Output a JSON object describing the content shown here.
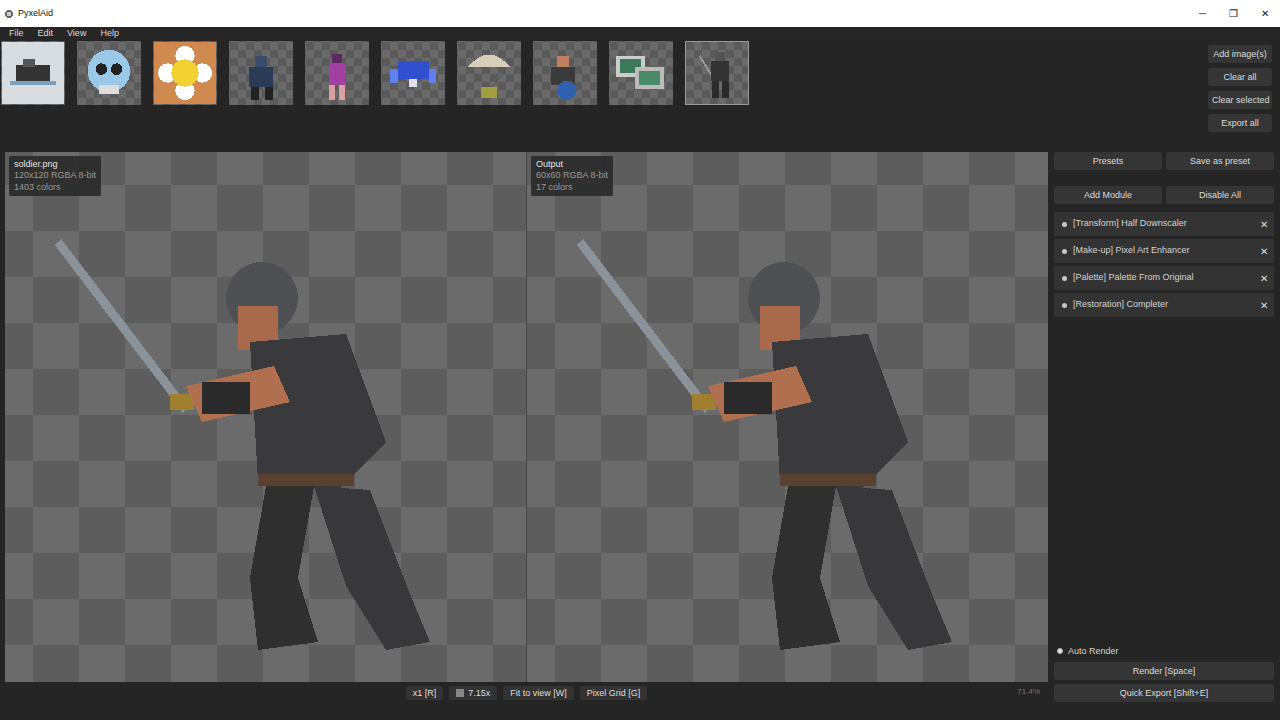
{
  "window": {
    "title": "PyxelAid",
    "controls": [
      "─",
      "❐",
      "✕"
    ]
  },
  "menu": [
    "File",
    "Edit",
    "View",
    "Help"
  ],
  "thumbnails": [
    {
      "selected": false
    },
    {
      "selected": false
    },
    {
      "selected": false
    },
    {
      "selected": false
    },
    {
      "selected": false
    },
    {
      "selected": false
    },
    {
      "selected": false
    },
    {
      "selected": false
    },
    {
      "selected": false
    },
    {
      "selected": true
    }
  ],
  "image_actions": [
    "Add image(s)",
    "Clear all",
    "Clear selected",
    "Export all"
  ],
  "source": {
    "filename": "soldier.png",
    "info": "120x120  RGBA  8-bit",
    "colors": "1403 colors"
  },
  "output": {
    "title": "Output",
    "info": "60x60  RGBA  8-bit",
    "colors": "17 colors"
  },
  "view_bar": {
    "zoom_reset": "x1 [R]",
    "zoom": "7.15x",
    "fit": "Fit to view [W]",
    "grid": "Pixel Grid [G]",
    "percent": "71.4%"
  },
  "panel": {
    "presets": "Presets",
    "save_preset": "Save as preset",
    "add_module": "Add Module",
    "disable_all": "Disable All",
    "modules": [
      {
        "label": "[Transform] Half Downscaler",
        "enabled": true,
        "remove": "✕"
      },
      {
        "label": "[Make-up] Pixel Art Enhancer",
        "enabled": true,
        "remove": "✕"
      },
      {
        "label": "[Palette] Palette From Original",
        "enabled": true,
        "remove": "✕"
      },
      {
        "label": "[Restoration] Completer",
        "enabled": true,
        "remove": "✕"
      }
    ],
    "auto_render": {
      "label": "Auto Render",
      "checked": true
    },
    "render": "Render  [Space]",
    "quick_export": "Quick Export  [Shift+E]"
  }
}
